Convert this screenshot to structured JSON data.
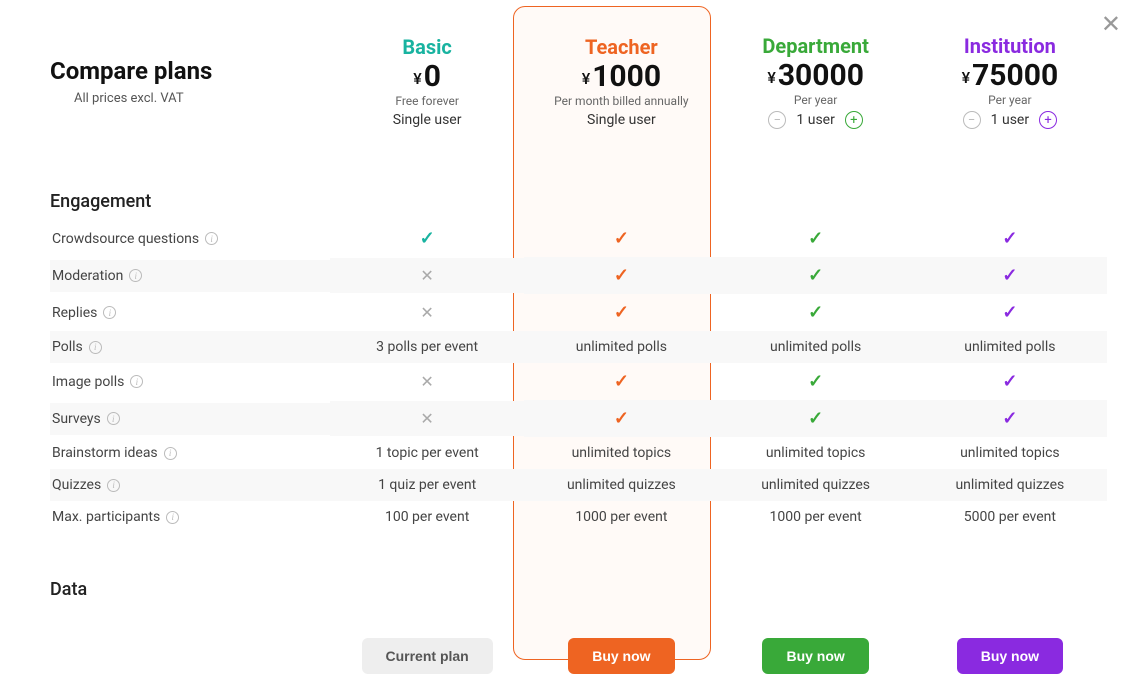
{
  "title": "Compare plans",
  "subtitle": "All prices excl. VAT",
  "close": "✕",
  "currency": "¥",
  "plans": {
    "basic": {
      "name": "Basic",
      "price": "0",
      "meta1": "Free forever",
      "meta2": "Single user",
      "button": "Current plan"
    },
    "teacher": {
      "name": "Teacher",
      "price": "1000",
      "meta1": "Per month billed annually",
      "meta2": "Single user",
      "button": "Buy now"
    },
    "department": {
      "name": "Department",
      "price": "30000",
      "meta1": "Per year",
      "users": "1 user",
      "button": "Buy now"
    },
    "institution": {
      "name": "Institution",
      "price": "75000",
      "meta1": "Per year",
      "users": "1 user",
      "button": "Buy now"
    }
  },
  "sections": {
    "engagement": "Engagement",
    "data": "Data"
  },
  "features": [
    {
      "label": "Crowdsource questions",
      "basic": "check",
      "teacher": "check",
      "dept": "check",
      "inst": "check"
    },
    {
      "label": "Moderation",
      "basic": "x",
      "teacher": "check",
      "dept": "check",
      "inst": "check",
      "alt": true
    },
    {
      "label": "Replies",
      "basic": "x",
      "teacher": "check",
      "dept": "check",
      "inst": "check"
    },
    {
      "label": "Polls",
      "basic": "3 polls per event",
      "teacher": "unlimited polls",
      "dept": "unlimited polls",
      "inst": "unlimited polls",
      "alt": true
    },
    {
      "label": "Image polls",
      "basic": "x",
      "teacher": "check",
      "dept": "check",
      "inst": "check"
    },
    {
      "label": "Surveys",
      "basic": "x",
      "teacher": "check",
      "dept": "check",
      "inst": "check",
      "alt": true
    },
    {
      "label": "Brainstorm ideas",
      "basic": "1 topic per event",
      "teacher": "unlimited topics",
      "dept": "unlimited topics",
      "inst": "unlimited topics"
    },
    {
      "label": "Quizzes",
      "basic": "1 quiz per event",
      "teacher": "unlimited quizzes",
      "dept": "unlimited quizzes",
      "inst": "unlimited quizzes",
      "alt": true
    },
    {
      "label": "Max. participants",
      "basic": "100 per event",
      "teacher": "1000 per event",
      "dept": "1000 per event",
      "inst": "5000 per event"
    }
  ]
}
